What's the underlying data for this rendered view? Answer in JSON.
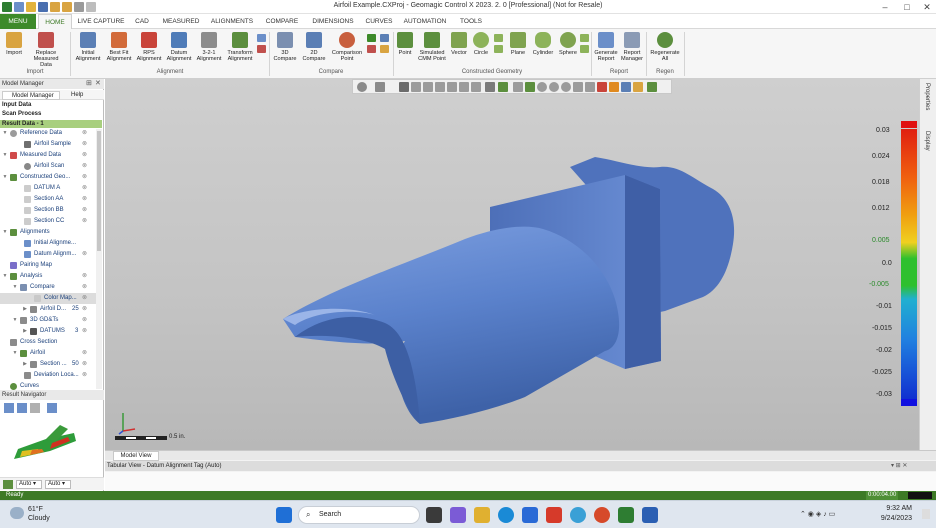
{
  "window": {
    "title": "Airfoil Example.CXProj - Geomagic Control X 2023. 2. 0 [Professional] (Not for Resale)"
  },
  "tabs": [
    "MENU",
    "HOME",
    "LIVE CAPTURE",
    "CAD",
    "MEASURED",
    "ALIGNMENTS",
    "COMPARE",
    "DIMENSIONS",
    "CURVES",
    "AUTOMATION",
    "TOOLS"
  ],
  "ribbon": {
    "buttons": [
      {
        "name": "import",
        "label": "Import"
      },
      {
        "name": "replace-measured-data",
        "label": "Replace Measured Data"
      },
      {
        "name": "initial-alignment",
        "label": "Initial Alignment"
      },
      {
        "name": "best-fit-alignment",
        "label": "Best Fit Alignment"
      },
      {
        "name": "rps-alignment",
        "label": "RPS Alignment"
      },
      {
        "name": "datum-alignment",
        "label": "Datum Alignment"
      },
      {
        "name": "3-2-1-alignment",
        "label": "3-2-1 Alignment"
      },
      {
        "name": "transform-alignment",
        "label": "Transform Alignment"
      },
      {
        "name": "3d-compare",
        "label": "3D Compare"
      },
      {
        "name": "2d-compare",
        "label": "2D Compare"
      },
      {
        "name": "comparison-point",
        "label": "Comparison Point"
      },
      {
        "name": "point",
        "label": "Point"
      },
      {
        "name": "simulated-cmm-point",
        "label": "Simulated CMM Point"
      },
      {
        "name": "vector",
        "label": "Vector"
      },
      {
        "name": "circle",
        "label": "Circle"
      },
      {
        "name": "plane",
        "label": "Plane"
      },
      {
        "name": "cylinder",
        "label": "Cylinder"
      },
      {
        "name": "sphere",
        "label": "Sphere"
      },
      {
        "name": "generate-report",
        "label": "Generate Report"
      },
      {
        "name": "report-manager",
        "label": "Report Manager"
      },
      {
        "name": "regenerate-all",
        "label": "Regenerate All"
      }
    ],
    "groups": [
      "Import",
      "Alignment",
      "Compare",
      "Constructed Geometry",
      "Report",
      "Regen"
    ]
  },
  "left_panel": {
    "header": "Model Manager",
    "tabs": [
      "Model Manager",
      "Help"
    ],
    "sections": [
      "Input Data",
      "Scan Process",
      "Result Data - 1"
    ],
    "tree": [
      {
        "label": "Reference Data"
      },
      {
        "label": "Airfoil Sample"
      },
      {
        "label": "Measured Data"
      },
      {
        "label": "Airfoil Scan"
      },
      {
        "label": "Constructed Geo..."
      },
      {
        "label": "DATUM A"
      },
      {
        "label": "Section AA"
      },
      {
        "label": "Section BB"
      },
      {
        "label": "Section CC"
      },
      {
        "label": "Alignments"
      },
      {
        "label": "Initial Alignme..."
      },
      {
        "label": "Datum Alignm..."
      },
      {
        "label": "Pairing Map"
      },
      {
        "label": "Analysis"
      },
      {
        "label": "Compare"
      },
      {
        "label": "Color Map..."
      },
      {
        "label": "Airfoil D...",
        "count": "25"
      },
      {
        "label": "3D GD&Ts"
      },
      {
        "label": "DATUMS",
        "count": "3"
      },
      {
        "label": "Cross Section"
      },
      {
        "label": "Airfoil"
      },
      {
        "label": "Section ...",
        "count": "50"
      },
      {
        "label": "Deviation Loca..."
      },
      {
        "label": "Curves"
      }
    ],
    "navigator_header": "Result Navigator",
    "auto_a": "Auto",
    "auto_b": "Auto"
  },
  "colorbar": {
    "labels": [
      "0.03",
      "0.024",
      "0.018",
      "0.012",
      "0.005",
      "0.0",
      "-0.005",
      "-0.01",
      "-0.015",
      "-0.02",
      "-0.025",
      "-0.03"
    ]
  },
  "viewport": {
    "scale_label": "0.5 in."
  },
  "right_strip": {
    "properties": "Properties",
    "display": "Display"
  },
  "bottom": {
    "model_view_tab": "Model View",
    "tabular_view": "Tabular View - Datum Alignment Tag (Auto)"
  },
  "status": {
    "left": "Ready",
    "time": "0:00:04.00"
  },
  "taskbar": {
    "weather_temp": "61°F",
    "weather_desc": "Cloudy",
    "search": "Search",
    "time": "9:32 AM",
    "date": "9/24/2023"
  },
  "colors": {
    "accent": "#3d8a2a",
    "part": "#5b82cc"
  }
}
